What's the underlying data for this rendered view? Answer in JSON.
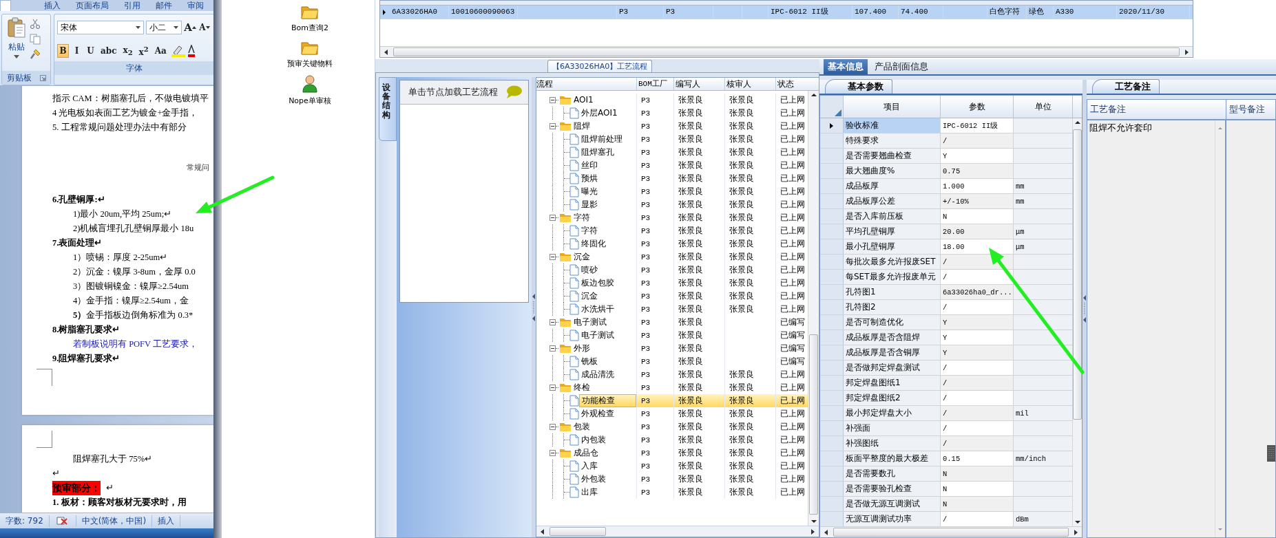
{
  "word": {
    "ribbon_tabs": [
      {
        "label": "插入",
        "selected": false
      },
      {
        "label": "页面布局",
        "selected": false
      },
      {
        "label": "引用",
        "selected": false
      },
      {
        "label": "邮件",
        "selected": false
      },
      {
        "label": "审阅",
        "selected": false
      }
    ],
    "clipboard": {
      "paste": "粘贴",
      "group": "剪贴板"
    },
    "font": {
      "family": "宋体",
      "size": "小二",
      "group": "字体",
      "grow": "A",
      "shrink": "A",
      "format_buttons": [
        {
          "label": "B",
          "on": true
        },
        {
          "label": "I",
          "on": false
        },
        {
          "label": "U",
          "on": false
        },
        {
          "label": "abc",
          "on": false
        },
        {
          "label": "x$_{2}$",
          "on": false
        },
        {
          "label": "x$^{2}$",
          "on": false
        },
        {
          "label": "Aa",
          "on": false
        }
      ]
    },
    "pages": [
      {
        "lines": [
          {
            "kind": "body",
            "text": "指示 CAM：树脂塞孔后，不做电镀填平"
          },
          {
            "kind": "body",
            "text": "4 光电板如表面工艺为镀金+金手指，"
          },
          {
            "kind": "body",
            "text": "5. 工程常规问题处理办法中有部分"
          },
          {
            "kind": "caption",
            "text": "常规问"
          },
          {
            "kind": "heading",
            "text": "6.孔壁铜厚:↵"
          },
          {
            "kind": "item",
            "text": "1)最小 20um,平均 25um;↵"
          },
          {
            "kind": "item",
            "text": "2)机械盲埋孔孔壁铜厚最小 18u"
          },
          {
            "kind": "heading",
            "text": "7.表面处理↵"
          },
          {
            "kind": "item",
            "text": "1）喷锡：厚度 2-25um↵"
          },
          {
            "kind": "item",
            "text": "2）沉金：镍厚 3-8um，金厚 0.0"
          },
          {
            "kind": "item",
            "text": "3）图镀铜镍金：镍厚≥2.54um"
          },
          {
            "kind": "item",
            "text": "4）金手指：镍厚≥2.54um，金"
          },
          {
            "kind": "item",
            "text": "**5）**金手指板边倒角标准为 0.3*"
          },
          {
            "kind": "heading",
            "text": "8.树脂塞孔要求↵"
          },
          {
            "kind": "note",
            "text": "若制板说明有 POFV 工艺要求，"
          },
          {
            "kind": "heading",
            "text": "9.阻焊塞孔要求↵"
          }
        ]
      },
      {
        "lines": [
          {
            "kind": "item",
            "text": "阻焊塞孔大于 75%↵"
          },
          {
            "kind": "body",
            "text": "↵"
          },
          {
            "kind": "highlight",
            "text": "预审部分：",
            "after": "↵"
          },
          {
            "kind": "heading",
            "text": "1.  板材：顾客对板材无要求时，用"
          }
        ]
      }
    ],
    "status_bar": {
      "word_count": "字数: 792",
      "language": "中文(简体，中国)",
      "mode": "插入"
    }
  },
  "nav": [
    {
      "kind": "folder",
      "label": "Bom查询2"
    },
    {
      "kind": "folder",
      "label": "预审关键物料"
    },
    {
      "kind": "user",
      "label": "Nope单审核"
    }
  ],
  "order_grid": {
    "rows": [
      {
        "selected": true,
        "column_1": "6A33026HA0",
        "column_2": "10010600090063",
        "column_4": "P3",
        "column_5": "P3",
        "column_8": "IPC-6012 II级",
        "column_9": "107.400",
        "column_10": "74.400",
        "column_12": "白色字符",
        "column_13": "绿色",
        "column_14": "A330",
        "column_15": "2020/11/30"
      }
    ]
  },
  "process": {
    "tab": "【6A33026HA0】工艺流程",
    "side_tab": "设备结构",
    "hint": "单击节点加载工艺流程",
    "columns": [
      "流程",
      "BOM工厂",
      "编写人",
      "核审人",
      "状态"
    ],
    "tree": [
      {
        "label": "AOI1",
        "bom": "P3",
        "writer": "张景良",
        "reviewer": "张景良",
        "status": "已上网",
        "expanded": true,
        "selected": false,
        "children": [
          {
            "label": "外层AOI1",
            "bom": "P3",
            "writer": "张景良",
            "reviewer": "张景良",
            "status": "已上网",
            "selected": false
          }
        ]
      },
      {
        "label": "阻焊",
        "bom": "P3",
        "writer": "张景良",
        "reviewer": "张景良",
        "status": "已上网",
        "expanded": true,
        "selected": false,
        "children": [
          {
            "label": "阻焊前处理",
            "bom": "P3",
            "writer": "张景良",
            "reviewer": "张景良",
            "status": "已上网",
            "selected": false
          },
          {
            "label": "阻焊塞孔",
            "bom": "P3",
            "writer": "张景良",
            "reviewer": "张景良",
            "status": "已上网",
            "selected": false
          },
          {
            "label": "丝印",
            "bom": "P3",
            "writer": "张景良",
            "reviewer": "张景良",
            "status": "已上网",
            "selected": false
          },
          {
            "label": "预烘",
            "bom": "P3",
            "writer": "张景良",
            "reviewer": "张景良",
            "status": "已上网",
            "selected": false
          },
          {
            "label": "曝光",
            "bom": "P3",
            "writer": "张景良",
            "reviewer": "张景良",
            "status": "已上网",
            "selected": false
          },
          {
            "label": "显影",
            "bom": "P3",
            "writer": "张景良",
            "reviewer": "张景良",
            "status": "已上网",
            "selected": false
          }
        ]
      },
      {
        "label": "字符",
        "bom": "P3",
        "writer": "张景良",
        "reviewer": "张景良",
        "status": "已上网",
        "expanded": true,
        "selected": false,
        "children": [
          {
            "label": "字符",
            "bom": "P3",
            "writer": "张景良",
            "reviewer": "张景良",
            "status": "已上网",
            "selected": false
          },
          {
            "label": "终固化",
            "bom": "P3",
            "writer": "张景良",
            "reviewer": "张景良",
            "status": "已上网",
            "selected": false
          }
        ]
      },
      {
        "label": "沉金",
        "bom": "P3",
        "writer": "张景良",
        "reviewer": "张景良",
        "status": "已上网",
        "expanded": true,
        "selected": false,
        "children": [
          {
            "label": "喷砂",
            "bom": "P3",
            "writer": "张景良",
            "reviewer": "张景良",
            "status": "已上网",
            "selected": false
          },
          {
            "label": "板边包胶",
            "bom": "P3",
            "writer": "张景良",
            "reviewer": "张景良",
            "status": "已上网",
            "selected": false
          },
          {
            "label": "沉金",
            "bom": "P3",
            "writer": "张景良",
            "reviewer": "张景良",
            "status": "已上网",
            "selected": false
          },
          {
            "label": "水洗烘干",
            "bom": "P3",
            "writer": "张景良",
            "reviewer": "张景良",
            "status": "已上网",
            "selected": false
          }
        ]
      },
      {
        "label": "电子测试",
        "bom": "P3",
        "writer": "张景良",
        "status": "已编写",
        "expanded": true,
        "selected": false,
        "children": [
          {
            "label": "电子测试",
            "bom": "P3",
            "writer": "张景良",
            "status": "已编写",
            "selected": false
          }
        ]
      },
      {
        "label": "外形",
        "bom": "P3",
        "writer": "张景良",
        "status": "已编写",
        "expanded": true,
        "selected": false,
        "children": [
          {
            "label": "铣板",
            "bom": "P3",
            "writer": "张景良",
            "status": "已编写",
            "selected": false
          },
          {
            "label": "成品清洗",
            "bom": "P3",
            "writer": "张景良",
            "reviewer": "张景良",
            "status": "已上网",
            "selected": false
          }
        ]
      },
      {
        "label": "终检",
        "bom": "P3",
        "writer": "张景良",
        "reviewer": "张景良",
        "status": "已上网",
        "expanded": true,
        "selected": false,
        "children": [
          {
            "label": "功能检查",
            "bom": "P3",
            "writer": "张景良",
            "reviewer": "张景良",
            "status": "已上网",
            "selected": true
          },
          {
            "label": "外观检查",
            "bom": "P3",
            "writer": "张景良",
            "reviewer": "张景良",
            "status": "已上网",
            "selected": false
          }
        ]
      },
      {
        "label": "包装",
        "bom": "P3",
        "writer": "张景良",
        "reviewer": "张景良",
        "status": "已上网",
        "expanded": true,
        "selected": false,
        "children": [
          {
            "label": "内包装",
            "bom": "P3",
            "writer": "张景良",
            "reviewer": "张景良",
            "status": "已上网",
            "selected": false
          }
        ]
      },
      {
        "label": "成品仓",
        "bom": "P3",
        "writer": "张景良",
        "reviewer": "张景良",
        "status": "已上网",
        "expanded": true,
        "selected": false,
        "children": [
          {
            "label": "入库",
            "bom": "P3",
            "writer": "张景良",
            "reviewer": "张景良",
            "status": "已上网",
            "selected": false
          },
          {
            "label": "外包装",
            "bom": "P3",
            "writer": "张景良",
            "reviewer": "张景良",
            "status": "已上网",
            "selected": false
          },
          {
            "label": "出库",
            "bom": "P3",
            "writer": "张景良",
            "reviewer": "张景良",
            "status": "已上网",
            "selected": false
          }
        ]
      }
    ]
  },
  "info": {
    "tabs": [
      {
        "label": "基本信息",
        "selected": true
      },
      {
        "label": "产品剖面信息",
        "selected": false
      }
    ],
    "params_tab": "基本参数",
    "params_columns": [
      "项目",
      "参数",
      "单位"
    ],
    "params": [
      {
        "item": "验收标准",
        "value": "IPC-6012 II级",
        "selected": true
      },
      {
        "item": "特殊要求",
        "value": "/",
        "selected": false
      },
      {
        "item": "是否需要翘曲检查",
        "value": "Y",
        "selected": false
      },
      {
        "item": "最大翘曲度%",
        "value": "0.75",
        "selected": false
      },
      {
        "item": "成品板厚",
        "value": "1.000",
        "unit": "mm",
        "selected": false
      },
      {
        "item": "成品板厚公差",
        "value": "+/-10%",
        "unit": "mm",
        "selected": false
      },
      {
        "item": "是否入库前压板",
        "value": "N",
        "selected": false
      },
      {
        "item": "平均孔壁铜厚",
        "value": "20.00",
        "unit": "μm",
        "selected": false
      },
      {
        "item": "最小孔壁铜厚",
        "value": "18.00",
        "unit": "μm",
        "selected": false
      },
      {
        "item": "每批次最多允许报废SET",
        "value": "/",
        "selected": false
      },
      {
        "item": "每SET最多允许报废单元",
        "value": "/",
        "selected": false
      },
      {
        "item": "孔符图1",
        "value": "6a33026ha0_dr...",
        "selected": false
      },
      {
        "item": "孔符图2",
        "value": "/",
        "selected": false
      },
      {
        "item": "是否可制造优化",
        "value": "Y",
        "selected": false
      },
      {
        "item": "成品板厚是否含阻焊",
        "value": "Y",
        "selected": false
      },
      {
        "item": "成品板厚是否含铜厚",
        "value": "Y",
        "selected": false
      },
      {
        "item": "是否做邦定焊盘测试",
        "value": "/",
        "selected": false
      },
      {
        "item": "邦定焊盘图纸1",
        "value": "/",
        "selected": false
      },
      {
        "item": "邦定焊盘图纸2",
        "value": "/",
        "selected": false
      },
      {
        "item": "最小邦定焊盘大小",
        "value": "/",
        "unit": "mil",
        "selected": false
      },
      {
        "item": "补强面",
        "value": "/",
        "selected": false
      },
      {
        "item": "补强图纸",
        "value": "/",
        "selected": false
      },
      {
        "item": "板面平整度的最大极差",
        "value": "0.15",
        "unit": "mm/inch",
        "selected": false
      },
      {
        "item": "是否需要数孔",
        "value": "N",
        "selected": false
      },
      {
        "item": "是否需要验孔检查",
        "value": "N",
        "selected": false
      },
      {
        "item": "是否做无源互调测试",
        "value": "N",
        "selected": false
      },
      {
        "item": "无源互调测试功率",
        "value": "/",
        "unit": "dBm",
        "selected": false
      }
    ],
    "notes_tab": "工艺备注",
    "notes_columns": [
      "工艺备注",
      "型号备注"
    ],
    "notes": [
      "阻焊不允许套印"
    ]
  }
}
